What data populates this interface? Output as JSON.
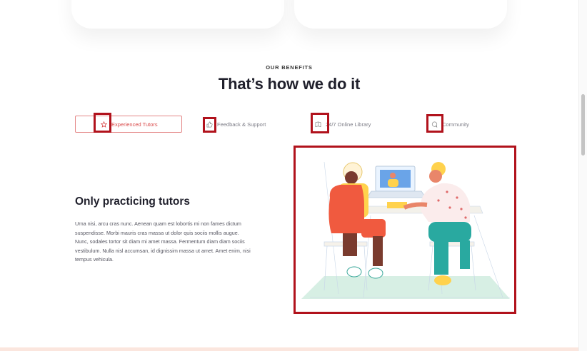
{
  "section": {
    "eyebrow": "OUR BENEFITS",
    "heading": "That’s how we do it"
  },
  "tabs": [
    {
      "label": "Experienced Tutors",
      "icon": "star-icon",
      "active": true
    },
    {
      "label": "Feedback & Support",
      "icon": "thumbs-up-icon",
      "active": false
    },
    {
      "label": "24/7 Online Library",
      "icon": "book-icon",
      "active": false
    },
    {
      "label": "Community",
      "icon": "chat-bubble-icon",
      "active": false
    }
  ],
  "feature": {
    "title": "Only practicing tutors",
    "text": "Urna nisi, arcu cras nunc. Aenean quam est lobortis mi non fames dictum suspendisse. Morbi mauris cras massa ut dolor quis sociis mollis augue. Nunc, sodales tortor sit diam mi amet massa. Fermentum diam diam sociis vestibulum. Nulla nisl accumsan, id dignissim massa ut amet. Amet enim, nisi tempus vehicula."
  },
  "colors": {
    "accent": "#d94a4a",
    "highlight_box": "#b1121c",
    "heading": "#1f1f2b"
  }
}
